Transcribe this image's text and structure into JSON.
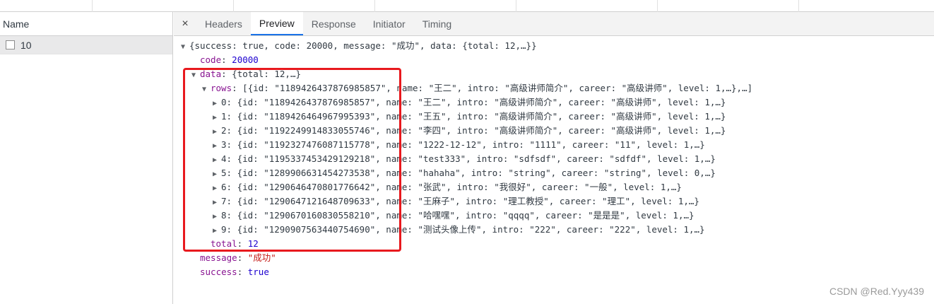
{
  "left_panel": {
    "header": "Name",
    "request": "10"
  },
  "tabs": {
    "close": "×",
    "items": [
      "Headers",
      "Preview",
      "Response",
      "Initiator",
      "Timing"
    ],
    "active": "Preview"
  },
  "tree": {
    "root_summary": "{success: true, code: 20000, message: \"成功\", data: {total: 12,…}}",
    "code_key": "code",
    "code_value": "20000",
    "data_key": "data",
    "data_summary": "{total: 12,…}",
    "rows_key": "rows",
    "rows_summary": "[{id: \"1189426437876985857\", name: \"王二\", intro: \"高级讲师简介\", career: \"高级讲师\", level: 1,…},…]",
    "rows": [
      "0: {id: \"1189426437876985857\", name: \"王二\", intro: \"高级讲师简介\", career: \"高级讲师\", level: 1,…}",
      "1: {id: \"1189426464967995393\", name: \"王五\", intro: \"高级讲师简介\", career: \"高级讲师\", level: 1,…}",
      "2: {id: \"1192249914833055746\", name: \"李四\", intro: \"高级讲师简介\", career: \"高级讲师\", level: 1,…}",
      "3: {id: \"1192327476087115778\", name: \"1222-12-12\", intro: \"1111\", career: \"11\", level: 1,…}",
      "4: {id: \"1195337453429129218\", name: \"test333\", intro: \"sdfsdf\", career: \"sdfdf\", level: 1,…}",
      "5: {id: \"1289906631454273538\", name: \"hahaha\", intro: \"string\", career: \"string\", level: 0,…}",
      "6: {id: \"1290646470801776642\", name: \"张武\", intro: \"我很好\", career: \"一般\", level: 1,…}",
      "7: {id: \"1290647121648709633\", name: \"王麻子\", intro: \"理工教授\", career: \"理工\", level: 1,…}",
      "8: {id: \"1290670160830558210\", name: \"哈嘿嘿\", intro: \"qqqq\", career: \"是是是\", level: 1,…}",
      "9: {id: \"1290907563440754690\", name: \"测试头像上传\", intro: \"222\", career: \"222\", level: 1,…}"
    ],
    "total_key": "total",
    "total_value": "12",
    "message_key": "message",
    "message_value": "\"成功\"",
    "success_key": "success",
    "success_value": "true"
  },
  "watermark": "CSDN @Red.Yyy439",
  "colors": {
    "highlight_box": "#e8191e",
    "active_tab_underline": "#1a73e8",
    "key_color": "#881391",
    "number_color": "#1c00cf",
    "string_color": "#c41a16"
  }
}
